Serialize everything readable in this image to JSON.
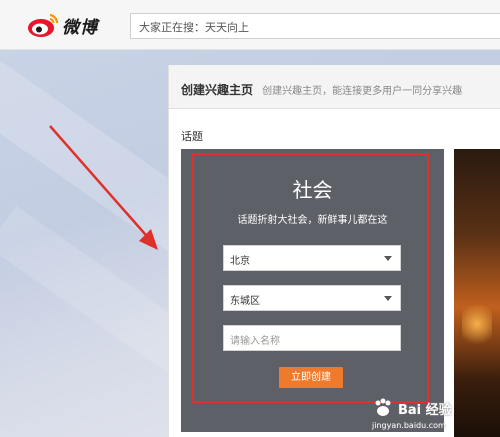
{
  "header": {
    "logo_text": "微博",
    "search_placeholder": "大家正在搜：天天向上"
  },
  "panel": {
    "title": "创建兴趣主页",
    "subtitle": "创建兴趣主页，能连接更多用户一同分享兴趣",
    "section_label": "话题"
  },
  "card": {
    "title": "社会",
    "description": "话题折射大社会，新鲜事儿都在这",
    "city_value": "北京",
    "district_value": "东城区",
    "name_placeholder": "请输入名称",
    "create_button": "立即创建"
  },
  "watermark": {
    "brand": "Bai 经验",
    "url": "jingyan.baidu.com"
  },
  "colors": {
    "card_background": "#5e6068",
    "highlight_frame": "#e0302a",
    "create_button": "#f07a2c",
    "arrow": "#e0302a"
  }
}
